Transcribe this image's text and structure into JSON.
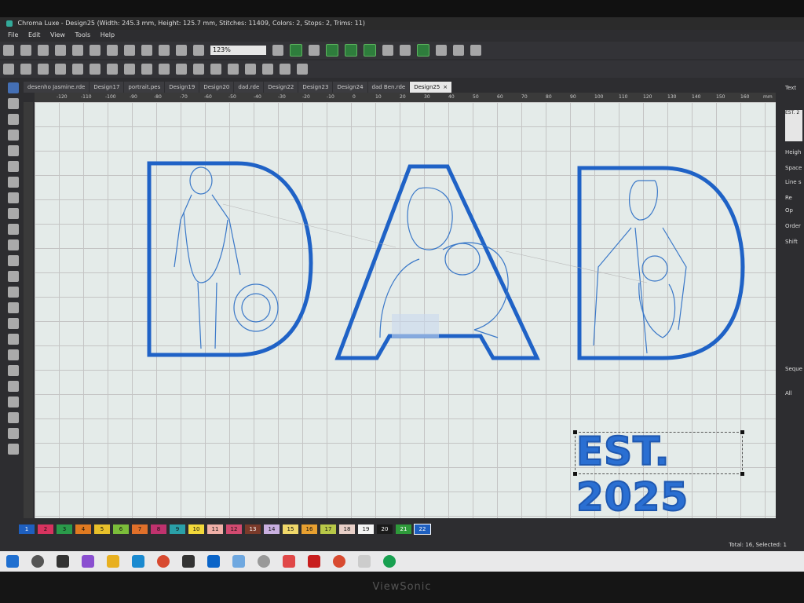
{
  "window": {
    "title": "Chroma Luxe - Design25 (Width: 245.3 mm, Height: 125.7 mm, Stitches: 11409, Colors: 2, Stops: 2, Trims: 11)"
  },
  "menu": [
    "File",
    "Edit",
    "View",
    "Tools",
    "Help"
  ],
  "toolbar": {
    "zoom_value": "123%"
  },
  "tabs": [
    {
      "label": "desenho Jasmine.rde"
    },
    {
      "label": "Design17"
    },
    {
      "label": "portrait.pes"
    },
    {
      "label": "Design19"
    },
    {
      "label": "Design20"
    },
    {
      "label": "dad.rde"
    },
    {
      "label": "Design22"
    },
    {
      "label": "Design23"
    },
    {
      "label": "Design24"
    },
    {
      "label": "dad Ben.rde"
    },
    {
      "label": "Design25",
      "active": true
    }
  ],
  "ruler": {
    "top_ticks": [
      "-120",
      "-110",
      "-100",
      "-90",
      "-80",
      "-70",
      "-60",
      "-50",
      "-40",
      "-30",
      "-20",
      "-10",
      "0",
      "10",
      "20",
      "30",
      "40",
      "50",
      "60",
      "70",
      "80",
      "90",
      "100",
      "110",
      "120",
      "130",
      "140",
      "150",
      "160"
    ],
    "unit": "mm"
  },
  "canvas": {
    "text_object": "EST. 2025",
    "stitch_color": "#1f62c6",
    "fill_color": "#2a6fd2"
  },
  "right_panel": {
    "header": "Text",
    "value_box": "EST. 2",
    "labels": [
      "Heigh",
      "Space",
      "Line s",
      "Re",
      "Op",
      "Order",
      "Shift"
    ],
    "sequence_header": "Seque",
    "all_label": "All"
  },
  "palette": [
    {
      "num": "1",
      "color": "#1e5fbf"
    },
    {
      "num": "2",
      "color": "#d7335f"
    },
    {
      "num": "3",
      "color": "#2a9a4a"
    },
    {
      "num": "4",
      "color": "#e07a20"
    },
    {
      "num": "5",
      "color": "#e8c02a"
    },
    {
      "num": "6",
      "color": "#7bbd3a"
    },
    {
      "num": "7",
      "color": "#e0702a"
    },
    {
      "num": "8",
      "color": "#c0326e"
    },
    {
      "num": "9",
      "color": "#2aa0a8"
    },
    {
      "num": "10",
      "color": "#f2d83a"
    },
    {
      "num": "11",
      "color": "#f0b0a8"
    },
    {
      "num": "12",
      "color": "#d24a70"
    },
    {
      "num": "13",
      "color": "#7a3a2a"
    },
    {
      "num": "14",
      "color": "#c9b0e0"
    },
    {
      "num": "15",
      "color": "#f0d86a"
    },
    {
      "num": "16",
      "color": "#e8a030"
    },
    {
      "num": "17",
      "color": "#b8c848"
    },
    {
      "num": "18",
      "color": "#e8d0c8"
    },
    {
      "num": "19",
      "color": "#f4f4f4"
    },
    {
      "num": "20",
      "color": "#1a1a1a"
    },
    {
      "num": "21",
      "color": "#2e9a3a"
    },
    {
      "num": "22",
      "color": "#1e5fbf"
    }
  ],
  "status": {
    "summary": "Total: 16, Selected: 1"
  },
  "monitor_brand": "ViewSonic"
}
